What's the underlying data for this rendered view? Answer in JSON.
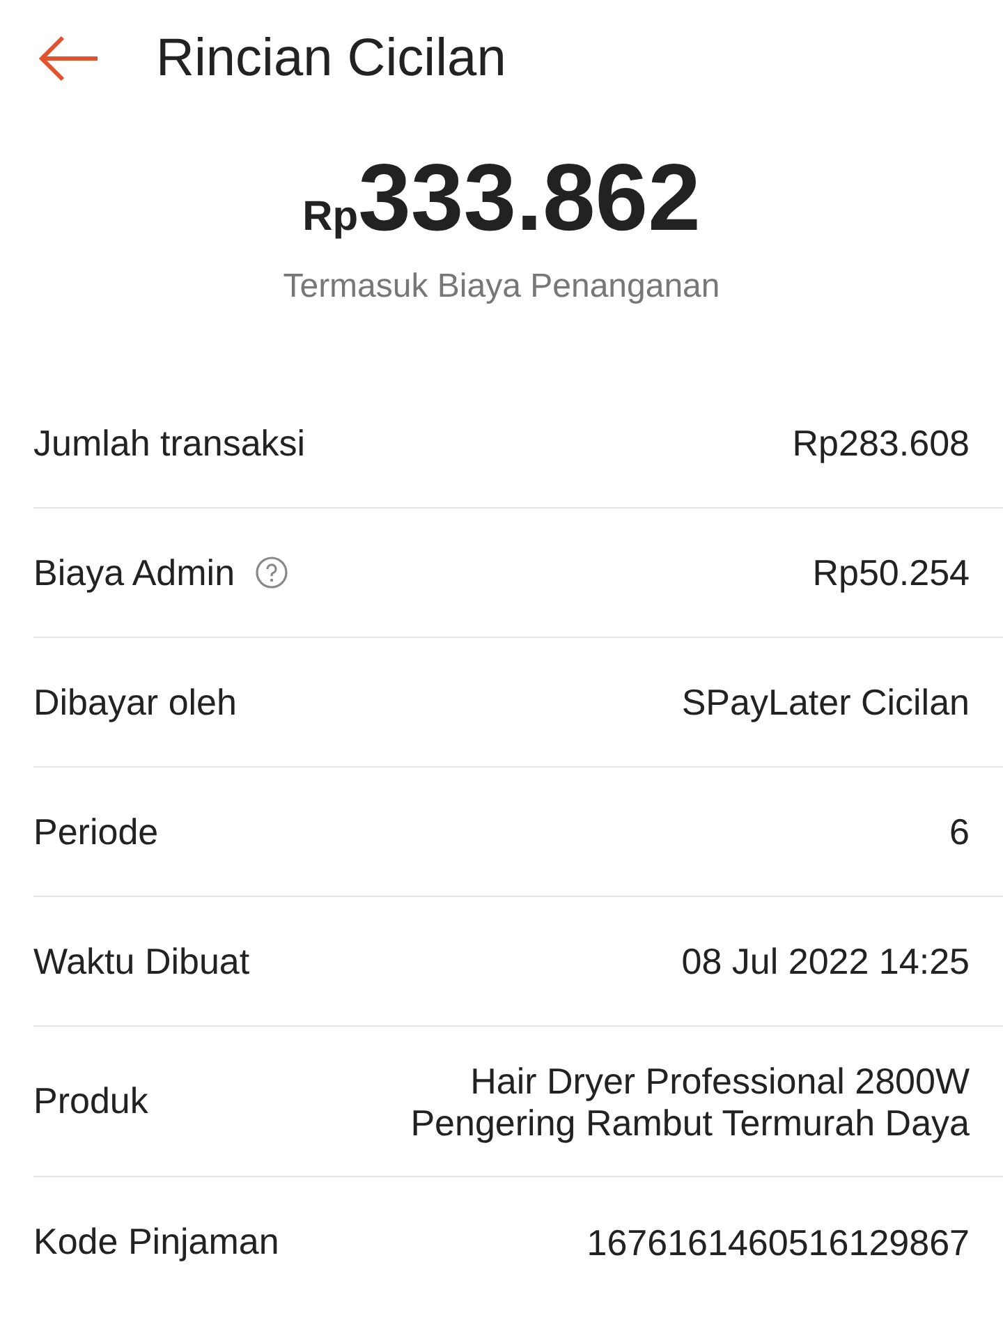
{
  "header": {
    "title": "Rincian Cicilan"
  },
  "amount": {
    "currency": "Rp",
    "value": "333.862",
    "note": "Termasuk Biaya Penanganan"
  },
  "rows": [
    {
      "label": "Jumlah transaksi",
      "value": [
        "Rp283.608"
      ],
      "info": false
    },
    {
      "label": "Biaya Admin",
      "value": [
        "Rp50.254"
      ],
      "info": true
    },
    {
      "label": "Dibayar oleh",
      "value": [
        "SPayLater Cicilan"
      ],
      "info": false
    },
    {
      "label": "Periode",
      "value": [
        "6"
      ],
      "info": false
    },
    {
      "label": "Waktu Dibuat",
      "value": [
        "08 Jul 2022 14:25"
      ],
      "info": false
    },
    {
      "label": "Produk",
      "value": [
        "Hair Dryer Professional 2800W",
        "Pengering Rambut Termurah Daya"
      ],
      "info": false
    },
    {
      "label": "Kode Pinjaman",
      "value": [
        "1676161460516129867"
      ],
      "info": false
    }
  ]
}
